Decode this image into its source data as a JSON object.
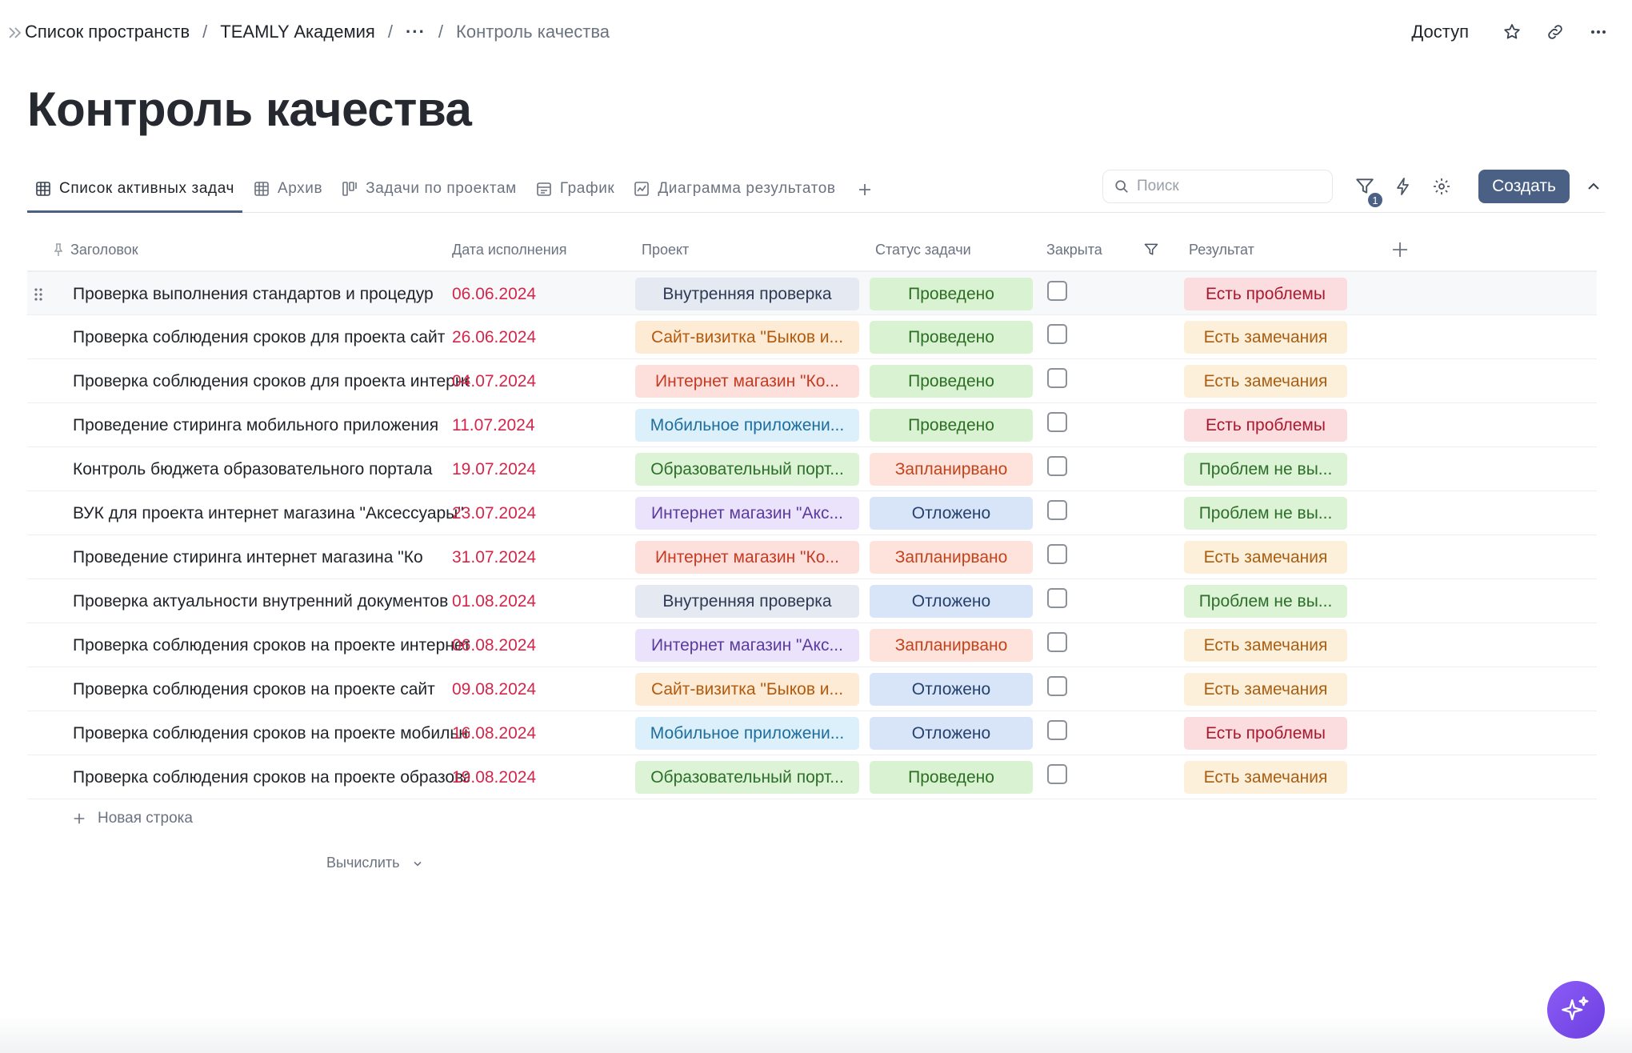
{
  "breadcrumb": {
    "items": [
      "Список пространств",
      "TEAMLY Академия",
      "···",
      "Контроль качества"
    ]
  },
  "top_actions": {
    "access": "Доступ"
  },
  "page_title": "Контроль качества",
  "tabs": [
    {
      "label": "Список активных задач",
      "icon": "table-icon",
      "active": true
    },
    {
      "label": "Архив",
      "icon": "table-icon"
    },
    {
      "label": "Задачи по проектам",
      "icon": "kanban-icon"
    },
    {
      "label": "График",
      "icon": "calendar-icon"
    },
    {
      "label": "Диаграмма результатов",
      "icon": "chart-icon"
    }
  ],
  "tools": {
    "search_placeholder": "Поиск",
    "filter_count": "1",
    "create_label": "Создать"
  },
  "columns": {
    "title": "Заголовок",
    "date": "Дата исполнения",
    "project": "Проект",
    "status": "Статус задачи",
    "closed": "Закрыта",
    "result": "Результат"
  },
  "colors": {
    "accent": "#4a6185",
    "date": "#d4264b",
    "project_internal": {
      "bg": "#e5e9f2",
      "fg": "#2d3a52"
    },
    "project_site": {
      "bg": "#fdebd6",
      "fg": "#b35a0c"
    },
    "project_shop_ko": {
      "bg": "#fde0dc",
      "fg": "#c53a22"
    },
    "project_mobile": {
      "bg": "#dbf0fa",
      "fg": "#1e6d9c"
    },
    "project_edu": {
      "bg": "#dcf3d6",
      "fg": "#2d6e2a"
    },
    "project_shop_acc": {
      "bg": "#ebe2fb",
      "fg": "#5a3a9e"
    },
    "status_done": {
      "bg": "#d9f2d1",
      "fg": "#2c6e23"
    },
    "status_planned": {
      "bg": "#fde3db",
      "fg": "#c2431b"
    },
    "status_postponed": {
      "bg": "#d8e4f8",
      "fg": "#25426e"
    },
    "result_problems": {
      "bg": "#fbdde0",
      "fg": "#a8182e"
    },
    "result_remarks": {
      "bg": "#fdf0da",
      "fg": "#a85f14"
    },
    "result_none": {
      "bg": "#dcf3d6",
      "fg": "#2d6e2a"
    }
  },
  "rows": [
    {
      "title": "Проверка выполнения стандартов и процедур",
      "date": "06.06.2024",
      "project": "Внутренняя проверка",
      "project_kind": "project_internal",
      "status": "Проведено",
      "status_kind": "status_done",
      "closed": false,
      "result": "Есть проблемы",
      "result_kind": "result_problems"
    },
    {
      "title": "Проверка соблюдения сроков для проекта сайт",
      "date": "26.06.2024",
      "project": "Сайт-визитка \"Быков и...",
      "project_kind": "project_site",
      "status": "Проведено",
      "status_kind": "status_done",
      "closed": false,
      "result": "Есть замечания",
      "result_kind": "result_remarks"
    },
    {
      "title": "Проверка соблюдения сроков для проекта интернет",
      "date": "04.07.2024",
      "project": "Интернет магазин \"Ко...",
      "project_kind": "project_shop_ko",
      "status": "Проведено",
      "status_kind": "status_done",
      "closed": false,
      "result": "Есть замечания",
      "result_kind": "result_remarks"
    },
    {
      "title": "Проведение стиринга мобильного приложения",
      "date": "11.07.2024",
      "project": "Мобильное приложени...",
      "project_kind": "project_mobile",
      "status": "Проведено",
      "status_kind": "status_done",
      "closed": false,
      "result": "Есть проблемы",
      "result_kind": "result_problems"
    },
    {
      "title": "Контроль бюджета образовательного портала",
      "date": "19.07.2024",
      "project": "Образовательный порт...",
      "project_kind": "project_edu",
      "status": "Запланирвано",
      "status_kind": "status_planned",
      "closed": false,
      "result": "Проблем не вы...",
      "result_kind": "result_none"
    },
    {
      "title": "ВУК для проекта интернет магазина \"Аксессуары\"",
      "date": "23.07.2024",
      "project": "Интернет магазин \"Акс...",
      "project_kind": "project_shop_acc",
      "status": "Отложено",
      "status_kind": "status_postponed",
      "closed": false,
      "result": "Проблем не вы...",
      "result_kind": "result_none"
    },
    {
      "title": "Проведение стиринга интернет магазина \"Ко",
      "date": "31.07.2024",
      "project": "Интернет магазин \"Ко...",
      "project_kind": "project_shop_ko",
      "status": "Запланирвано",
      "status_kind": "status_planned",
      "closed": false,
      "result": "Есть замечания",
      "result_kind": "result_remarks"
    },
    {
      "title": "Проверка актуальности внутренний документов",
      "date": "01.08.2024",
      "project": "Внутренняя проверка",
      "project_kind": "project_internal",
      "status": "Отложено",
      "status_kind": "status_postponed",
      "closed": false,
      "result": "Проблем не вы...",
      "result_kind": "result_none"
    },
    {
      "title": "Проверка соблюдения сроков на проекте интернет",
      "date": "06.08.2024",
      "project": "Интернет магазин \"Акс...",
      "project_kind": "project_shop_acc",
      "status": "Запланирвано",
      "status_kind": "status_planned",
      "closed": false,
      "result": "Есть замечания",
      "result_kind": "result_remarks"
    },
    {
      "title": "Проверка соблюдения сроков на проекте сайт",
      "date": "09.08.2024",
      "project": "Сайт-визитка \"Быков и...",
      "project_kind": "project_site",
      "status": "Отложено",
      "status_kind": "status_postponed",
      "closed": false,
      "result": "Есть замечания",
      "result_kind": "result_remarks"
    },
    {
      "title": "Проверка соблюдения сроков на проекте мобильного",
      "date": "16.08.2024",
      "project": "Мобильное приложени...",
      "project_kind": "project_mobile",
      "status": "Отложено",
      "status_kind": "status_postponed",
      "closed": false,
      "result": "Есть проблемы",
      "result_kind": "result_problems"
    },
    {
      "title": "Проверка соблюдения сроков на проекте образовательного",
      "date": "19.08.2024",
      "project": "Образовательный порт...",
      "project_kind": "project_edu",
      "status": "Проведено",
      "status_kind": "status_done",
      "closed": false,
      "result": "Есть замечания",
      "result_kind": "result_remarks"
    }
  ],
  "footer": {
    "new_row": "Новая строка",
    "compute": "Вычислить"
  }
}
